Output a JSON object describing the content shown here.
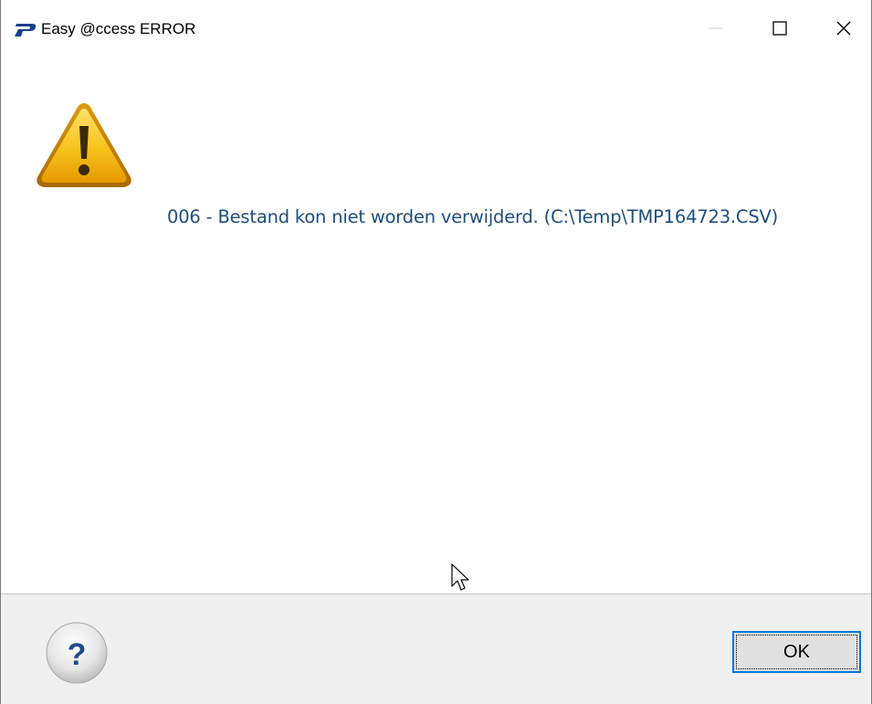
{
  "window": {
    "title": "Easy @ccess ERROR",
    "app_icon": "easy-access-logo",
    "controls": {
      "minimize": "minimize-icon",
      "maximize": "maximize-icon",
      "close": "close-icon"
    }
  },
  "dialog": {
    "icon": "warning-icon",
    "message": "006 - Bestand kon niet worden verwijderd. (C:\\Temp\\TMP164723.CSV)"
  },
  "footer": {
    "help_label": "?",
    "ok_label": "OK"
  },
  "colors": {
    "message_text": "#1f4e79",
    "ok_focus_border": "#0078d7",
    "footer_bg": "#f0f0f0",
    "warning_fill": "#f2b707",
    "help_glyph": "#1f4b8a"
  }
}
